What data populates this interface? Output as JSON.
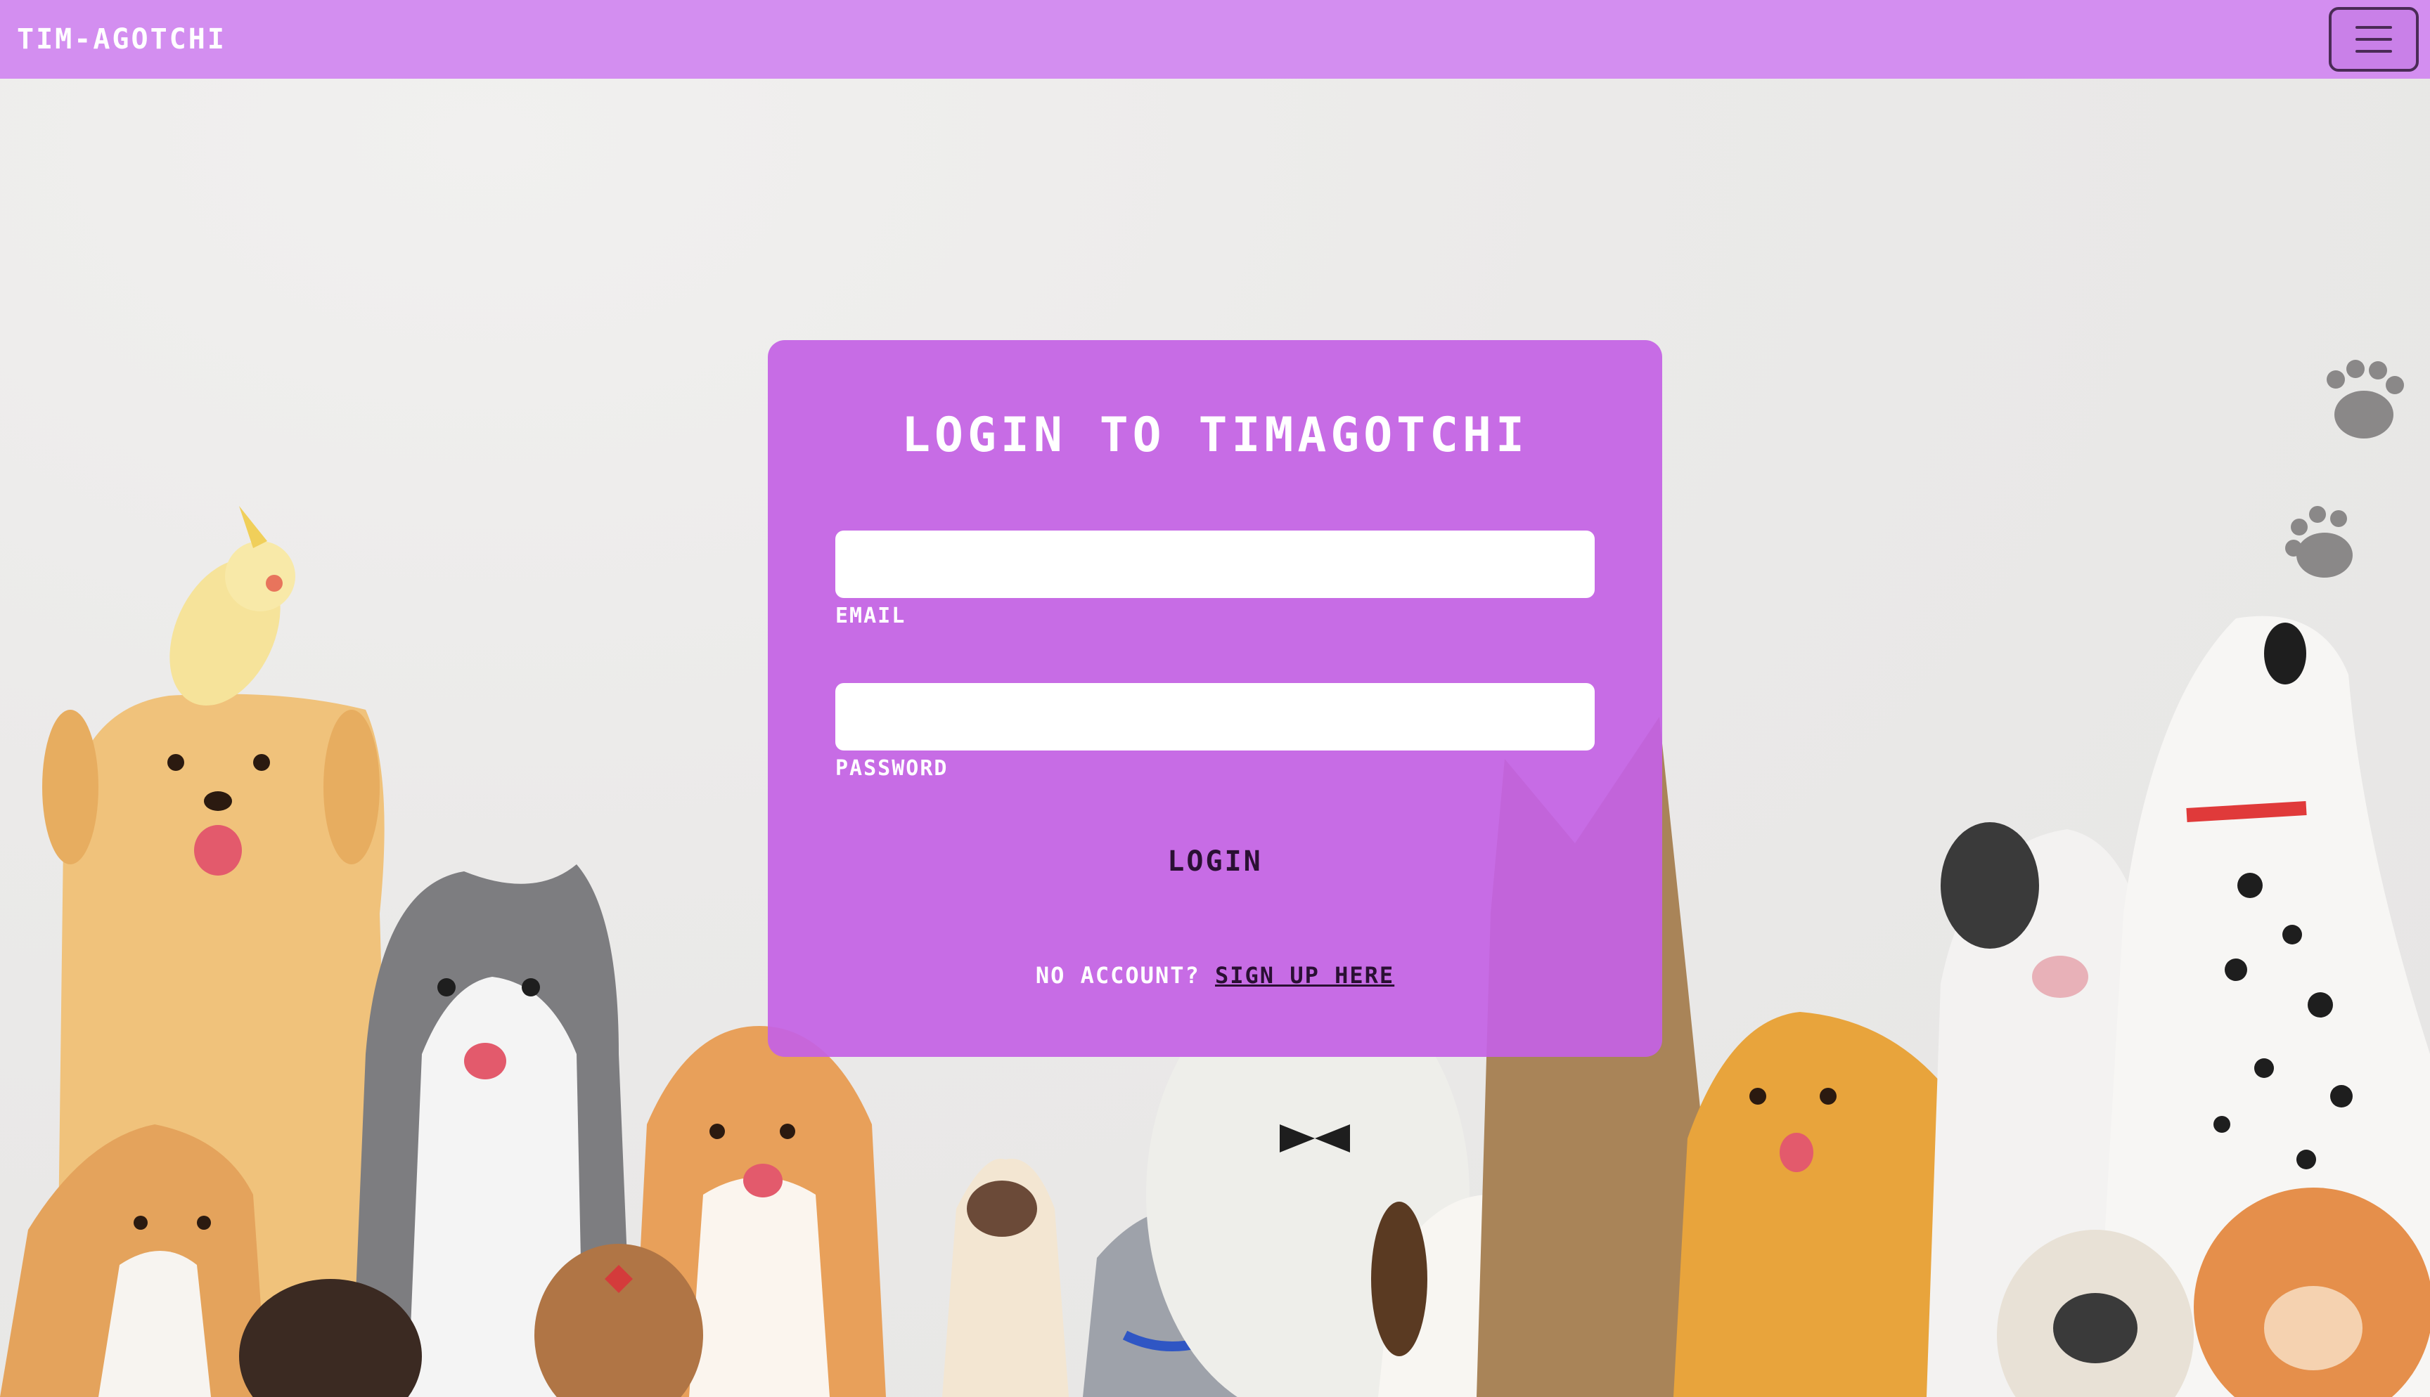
{
  "navbar": {
    "brand": "TIM-AGOTCHI"
  },
  "login_card": {
    "title": "LOGIN TO TIMAGOTCHI",
    "email_label": "EMAIL",
    "email_value": "",
    "password_label": "PASSWORD",
    "password_value": "",
    "login_button": "LOGIN",
    "no_account_text": "NO ACCOUNT?",
    "signup_link": "SIGN UP HERE"
  },
  "colors": {
    "navbar": "#d38ef0",
    "card": "#c462e4",
    "dark_text": "#2a1033"
  },
  "icons": [
    "menu-icon",
    "paw-print-icon"
  ]
}
